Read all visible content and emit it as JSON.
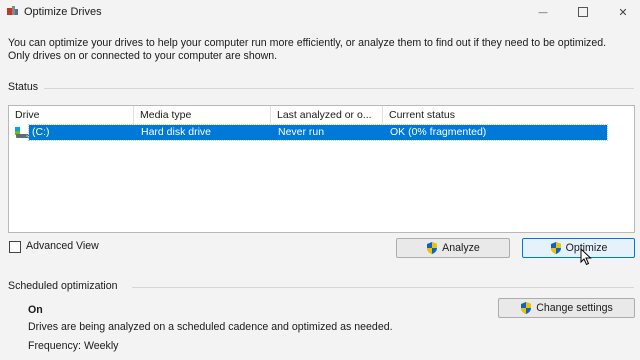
{
  "window": {
    "title": "Optimize Drives",
    "minimize_glyph": "—",
    "close_glyph": "✕"
  },
  "description": "You can optimize your drives to help your computer run more efficiently, or analyze them to find out if they need to be optimized. Only drives on or connected to your computer are shown.",
  "status": {
    "label": "Status",
    "columns": [
      "Drive",
      "Media type",
      "Last analyzed or o...",
      "Current status"
    ],
    "drives": [
      {
        "drive": "(C:)",
        "media_type": "Hard disk drive",
        "last_analyzed": "Never run",
        "current_status": "OK (0% fragmented)",
        "selected": true
      }
    ]
  },
  "advanced_view": {
    "label": "Advanced View",
    "checked": false
  },
  "buttons": {
    "analyze": "Analyze",
    "optimize": "Optimize",
    "change_settings": "Change settings"
  },
  "scheduled": {
    "label": "Scheduled optimization",
    "state": "On",
    "description": "Drives are being analyzed on a scheduled cadence and optimized as needed.",
    "frequency": "Frequency: Weekly"
  },
  "colors": {
    "selection": "#0078d7",
    "window_bg": "#f3f3f3"
  },
  "icons": {
    "app": "defrag-icon",
    "drive": "hard-drive-icon",
    "shield": "uac-shield-icon"
  }
}
